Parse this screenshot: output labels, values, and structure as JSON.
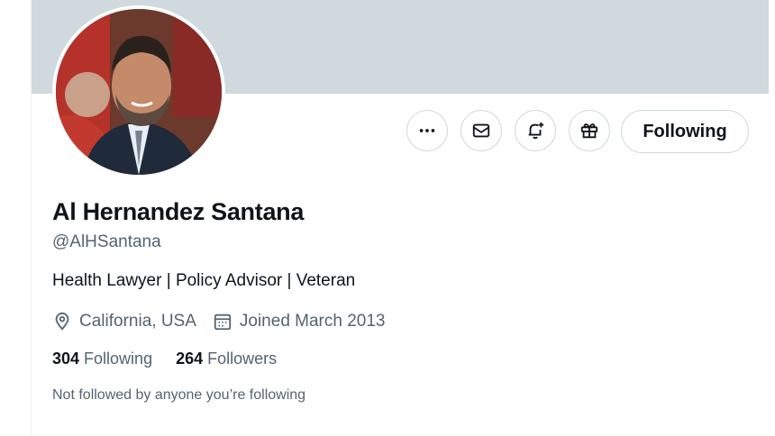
{
  "profile": {
    "display_name": "Al Hernandez Santana",
    "handle": "@AlHSantana",
    "bio": "Health Lawyer | Policy Advisor | Veteran",
    "location": "California, USA",
    "joined": "Joined March 2013",
    "following_count": "304",
    "following_label": "Following",
    "followers_count": "264",
    "followers_label": "Followers",
    "followed_by_note": "Not followed by anyone you’re following"
  },
  "actions": {
    "following_button": "Following",
    "icons": [
      "more-icon",
      "mail-icon",
      "bell-plus-icon",
      "gift-icon"
    ]
  },
  "colors": {
    "banner": "#cfd9de",
    "text_primary": "#0f1419",
    "text_secondary": "#536471",
    "border": "#cfd9de"
  }
}
